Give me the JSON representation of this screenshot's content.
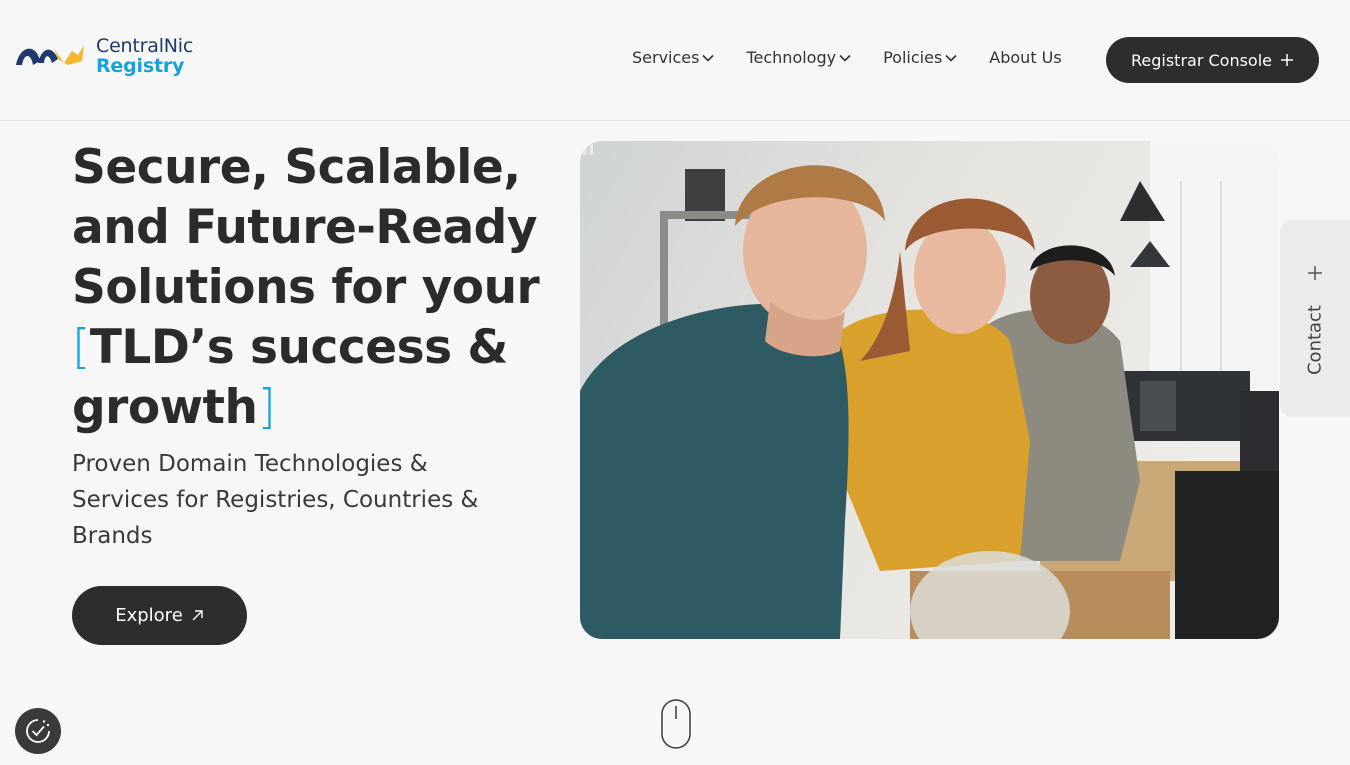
{
  "brand": {
    "name_line1": "CentralNic",
    "name_line2": "Registry",
    "colors": {
      "navy": "#1f3a6b",
      "blue": "#14a3dc",
      "yellow": "#f5b82e"
    }
  },
  "nav": {
    "items": [
      {
        "label": "Services",
        "icon": "chevron-down-icon"
      },
      {
        "label": "Technology",
        "icon": "chevron-down-icon"
      },
      {
        "label": "Policies",
        "icon": "chevron-down-icon"
      },
      {
        "label": "About Us"
      }
    ],
    "console_button": {
      "label": "Registrar Console",
      "icon": "plus-icon"
    }
  },
  "hero": {
    "title_lines": [
      "Secure, Scalable,",
      "and Future-Ready",
      "Solutions for your"
    ],
    "highlight_lines": [
      "TLD’s success &",
      "growth"
    ],
    "bracket_open": "[",
    "bracket_close": "]",
    "subtitle": "Proven Domain Technologies & Services for Registries, Countries & Brands",
    "cta_label": "Explore",
    "cta_icon": "arrow-up-right-icon",
    "accent_color": "#14a3dc",
    "media_controls": {
      "pause_icon": "pause-icon"
    }
  },
  "contact_tab": {
    "label": "Contact",
    "icon": "plus-icon"
  },
  "scroll_indicator": {
    "icon": "mouse-scroll-icon"
  },
  "cookie_settings": {
    "icon": "cookie-consent-icon"
  }
}
